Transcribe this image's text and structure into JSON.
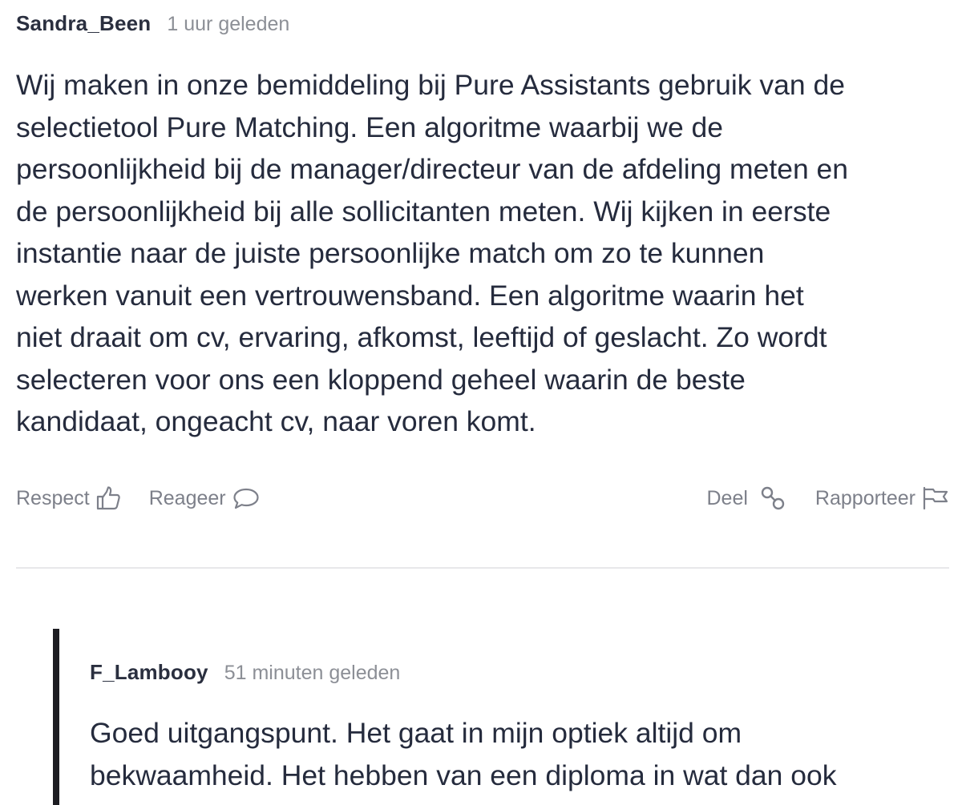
{
  "comments": [
    {
      "author": "Sandra_Been",
      "time": "1 uur geleden",
      "lines": [
        "Wij maken in onze bemiddeling bij Pure Assistants gebruik van de",
        "selectietool Pure Matching. Een algoritme waarbij we de",
        "persoonlijkheid bij de manager/directeur van de afdeling meten en",
        "de persoonlijkheid bij alle sollicitanten meten. Wij kijken in eerste",
        "instantie naar de juiste persoonlijke match om zo te kunnen",
        "werken vanuit een vertrouwensband. Een algoritme waarin het",
        "niet draait om cv, ervaring, afkomst, leeftijd of geslacht. Zo wordt",
        "selecteren voor ons een kloppend geheel waarin de beste",
        "kandidaat, ongeacht cv, naar voren komt."
      ]
    },
    {
      "author": "F_Lambooy",
      "time": "51 minuten geleden",
      "lines": [
        "Goed uitgangspunt. Het gaat in mijn optiek altijd om",
        "bekwaamheid. Het hebben van een diploma in wat dan ook"
      ]
    }
  ],
  "actions": {
    "respect": {
      "label": "Respect",
      "icon": "thumbs-up-icon"
    },
    "reply": {
      "label": "Reageer",
      "icon": "speech-bubble-icon"
    },
    "share": {
      "label": "Deel",
      "icon": "link-icon"
    },
    "report": {
      "label": "Rapporteer",
      "icon": "flag-icon"
    }
  },
  "colors": {
    "text": "#252b3d",
    "muted": "#8c8f96",
    "action": "#7d808a",
    "divider": "#e8e8ea",
    "reply_bar": "#1d1d22"
  }
}
